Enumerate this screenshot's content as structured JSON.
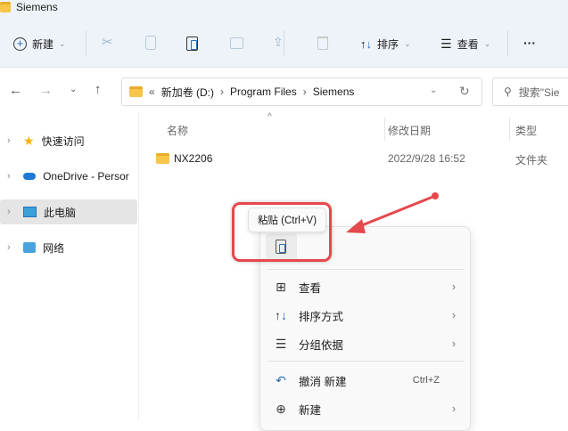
{
  "window": {
    "title": "Siemens"
  },
  "toolbar": {
    "new_label": "新建",
    "sort_label": "排序",
    "view_label": "查看",
    "more": "···"
  },
  "nav": {
    "breadcrumb": [
      "新加卷 (D:)",
      "Program Files",
      "Siemens"
    ],
    "overflow": "«",
    "search_placeholder": "搜索\"Sie"
  },
  "sidebar": {
    "items": [
      {
        "label": "快速访问"
      },
      {
        "label": "OneDrive - Persor"
      },
      {
        "label": "此电脑"
      },
      {
        "label": "网络"
      }
    ]
  },
  "columns": {
    "name": "名称",
    "modified": "修改日期",
    "type": "类型"
  },
  "files": [
    {
      "name": "NX2206",
      "modified": "2022/9/28 16:52",
      "type": "文件夹"
    }
  ],
  "tooltip": {
    "text": "粘贴 (Ctrl+V)"
  },
  "context_menu": {
    "items": [
      {
        "label": "查看"
      },
      {
        "label": "排序方式"
      },
      {
        "label": "分组依据"
      },
      {
        "label": "撤消 新建",
        "shortcut": "Ctrl+Z"
      },
      {
        "label": "新建"
      }
    ]
  },
  "colors": {
    "annotation": "#e5484d",
    "accent": "#2b6fb5"
  }
}
